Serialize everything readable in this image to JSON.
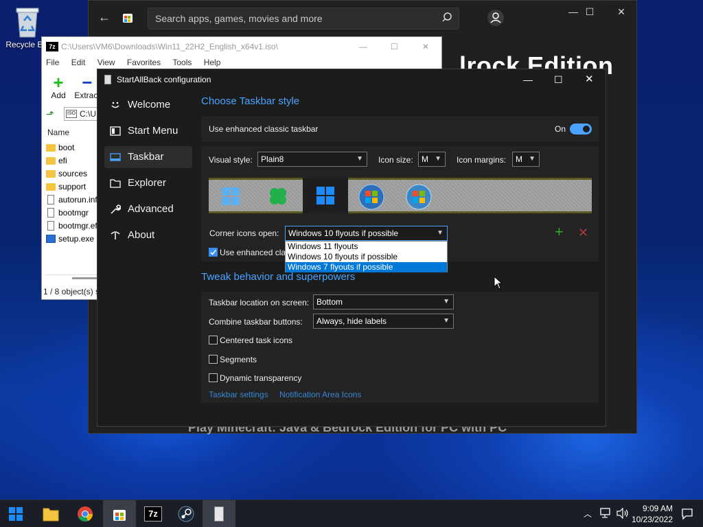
{
  "desktop": {
    "recycle_bin_label": "Recycle Bin"
  },
  "store": {
    "search_placeholder": "Search apps, games, movies and more",
    "heading_partial": "lrock Edition",
    "bottom_text": "Play Minecraft: Java & Bedrock Edition for PC with PC"
  },
  "zip": {
    "title": "C:\\Users\\VM6\\Downloads\\Win11_22H2_English_x64v1.iso\\",
    "menu": [
      "File",
      "Edit",
      "View",
      "Favorites",
      "Tools",
      "Help"
    ],
    "toolbar": {
      "add": "Add",
      "extract": "Extract"
    },
    "address": "C:\\U",
    "column_name": "Name",
    "files": [
      {
        "name": "boot",
        "type": "folder"
      },
      {
        "name": "efi",
        "type": "folder"
      },
      {
        "name": "sources",
        "type": "folder"
      },
      {
        "name": "support",
        "type": "folder"
      },
      {
        "name": "autorun.inf",
        "type": "file"
      },
      {
        "name": "bootmgr",
        "type": "file"
      },
      {
        "name": "bootmgr.efi",
        "type": "file"
      },
      {
        "name": "setup.exe",
        "type": "exe"
      }
    ],
    "status": "1 / 8 object(s) s"
  },
  "sab": {
    "title": "StartAllBack configuration",
    "nav": [
      {
        "label": "Welcome",
        "icon": "smiley-icon"
      },
      {
        "label": "Start Menu",
        "icon": "start-menu-icon"
      },
      {
        "label": "Taskbar",
        "icon": "taskbar-icon"
      },
      {
        "label": "Explorer",
        "icon": "folder-icon"
      },
      {
        "label": "Advanced",
        "icon": "wrench-icon"
      },
      {
        "label": "About",
        "icon": "info-icon"
      }
    ],
    "section1_title": "Choose Taskbar style",
    "enhanced_label": "Use enhanced classic taskbar",
    "toggle_state": "On",
    "visual_style_label": "Visual style:",
    "visual_style_value": "Plain8",
    "icon_size_label": "Icon size:",
    "icon_size_value": "M",
    "icon_margins_label": "Icon margins:",
    "icon_margins_value": "M",
    "corner_icons_label": "Corner icons open:",
    "corner_icons_value": "Windows 10 flyouts if possible",
    "corner_options": [
      "Windows 11 flyouts",
      "Windows 10 flyouts if possible",
      "Windows 7 flyouts if possible"
    ],
    "use_enhanced_partial": "Use enhanced clas",
    "section2_title": "Tweak behavior and superpowers",
    "location_label": "Taskbar location on screen:",
    "location_value": "Bottom",
    "combine_label": "Combine taskbar buttons:",
    "combine_value": "Always, hide labels",
    "centered_label": "Centered task icons",
    "segments_label": "Segments",
    "dynamic_label": "Dynamic transparency",
    "link_taskbar_settings": "Taskbar settings",
    "link_notification": "Notification Area Icons"
  },
  "taskbar": {
    "time": "9:09 AM",
    "date": "10/23/2022"
  }
}
